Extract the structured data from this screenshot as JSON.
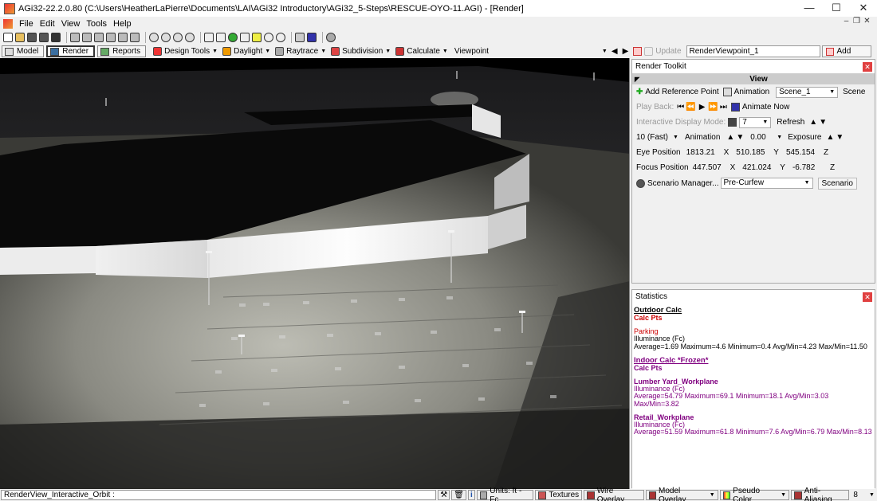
{
  "window": {
    "title": "AGi32-22.2.0.80 (C:\\Users\\HeatherLaPierre\\Documents\\LAI\\AGi32 Introductory\\AGi32_5-Steps\\RESCUE-OYO-11.AGI) - [Render]",
    "minimize": "—",
    "maximize": "☐",
    "close": "✕"
  },
  "menu": [
    "File",
    "Edit",
    "View",
    "Tools",
    "Help"
  ],
  "mdi_buttons": [
    "–",
    "❐",
    "✕"
  ],
  "toolbar2": {
    "tabs": [
      "Model",
      "Render",
      "Reports"
    ],
    "design_tools": "Design Tools",
    "daylight": "Daylight",
    "raytrace": "Raytrace",
    "subdivision": "Subdivision",
    "calculate": "Calculate",
    "viewpoint": "Viewpoint",
    "update": "Update",
    "render_viewpoint": "RenderViewpoint_1",
    "add": "Add"
  },
  "render_toolkit": {
    "title": "Render Toolkit",
    "view_label": "View",
    "add_reference_point": "Add Reference Point",
    "animation": "Animation",
    "scene_value": "Scene_1",
    "scene_label": "Scene",
    "play_back": "Play Back:",
    "animate_now": "Animate Now",
    "interactive_display_mode": "Interactive Display Mode:",
    "display_mode_value": "7",
    "refresh": "Refresh",
    "speed_value": "10 (Fast)",
    "animation_label": "Animation",
    "exposure_value": "0.00",
    "exposure_label": "Exposure",
    "eye_position_label": "Eye Position",
    "eye_x": "1813.21",
    "eye_y": "510.185",
    "eye_z": "545.154",
    "focus_position_label": "Focus Position",
    "focus_x": "447.507",
    "focus_y": "421.024",
    "focus_z": "-6.782",
    "x_label": "X",
    "y_label": "Y",
    "z_label": "Z",
    "scenario_manager": "Scenario Manager...",
    "scenario_value": "Pre-Curfew",
    "scenario_label": "Scenario"
  },
  "statistics": {
    "title": "Statistics",
    "outdoor_calc": "Outdoor Calc",
    "outdoor_calc_pts": "Calc Pts",
    "parking_name": "Parking",
    "parking_unit": "Illuminance (Fc)",
    "parking_stats": "Average=1.69   Maximum=4.6   Minimum=0.4   Avg/Min=4.23   Max/Min=11.50",
    "indoor_calc": "Indoor Calc *Frozen*",
    "indoor_calc_pts": "Calc Pts",
    "lumber_name": "Lumber Yard_Workplane",
    "lumber_unit": "Illuminance (Fc)",
    "lumber_stats": "Average=54.79   Maximum=69.1   Minimum=18.1   Avg/Min=3.03   Max/Min=3.82",
    "retail_name": "Retail_Workplane",
    "retail_unit": "Illuminance (Fc)",
    "retail_stats": "Average=51.59   Maximum=61.8   Minimum=7.6   Avg/Min=6.79   Max/Min=8.13"
  },
  "statusbar": {
    "text": "RenderView_Interactive_Orbit :",
    "units": "Units: ft - Fc",
    "textures": "Textures",
    "wire_overlay": "Wire Overlay",
    "model_overlay": "Model Overlay",
    "pseudo_color": "Pseudo Color",
    "anti_aliasing": "Anti-Aliasing",
    "aa_value": "8"
  }
}
